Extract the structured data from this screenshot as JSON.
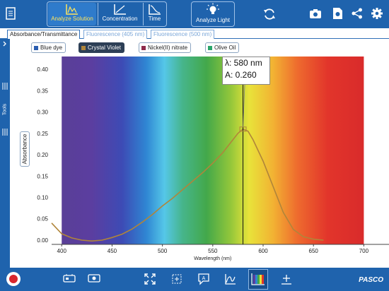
{
  "toolbar": {
    "analyze_solution": "Analyze Solution",
    "concentration": "Concentration",
    "time": "Time",
    "analyze_light": "Analyze Light"
  },
  "tabs": [
    {
      "label": "Absorbance/Transmittance",
      "active": true
    },
    {
      "label": "Fluorescence (405 nm)",
      "active": false
    },
    {
      "label": "Fluorescence (500 nm)",
      "active": false
    }
  ],
  "sidebar": {
    "tools_label": "Tools"
  },
  "legend": [
    {
      "label": "Blue dye",
      "color": "#2a5db0",
      "selected": false
    },
    {
      "label": "Crystal Violet",
      "color": "#b0853a",
      "selected": true
    },
    {
      "label": "Nickel(II) nitrate",
      "color": "#8e2a4a",
      "selected": false
    },
    {
      "label": "Olive Oil",
      "color": "#2aa56a",
      "selected": false
    }
  ],
  "cursor": {
    "wavelength": "λ: 580 nm",
    "absorbance": "A: 0.260"
  },
  "chart_data": {
    "type": "line",
    "xlabel": "Wavelength (nm)",
    "ylabel": "Absorbance",
    "xlim": [
      390,
      725
    ],
    "ylim": [
      -0.01,
      0.43
    ],
    "x_ticks": [
      400,
      450,
      500,
      550,
      600,
      650,
      700
    ],
    "y_ticks": [
      0.0,
      0.05,
      0.1,
      0.15,
      0.2,
      0.25,
      0.3,
      0.35,
      0.4
    ],
    "y_tick_labels": [
      "0.00",
      "0.05",
      "0.10",
      "0.15",
      "0.20",
      "0.25",
      "0.30",
      "0.35",
      "0.40"
    ],
    "background": "visible spectrum 400–700 nm",
    "series": [
      {
        "name": "Crystal Violet",
        "color": "#b0853a",
        "x": [
          390,
          400,
          410,
          420,
          430,
          440,
          450,
          460,
          470,
          480,
          490,
          500,
          510,
          520,
          530,
          540,
          550,
          560,
          570,
          575,
          580,
          585,
          590,
          600,
          610,
          620,
          630,
          640,
          650,
          660
        ],
        "y": [
          0.04,
          0.015,
          0.005,
          0.0,
          -0.002,
          0.0,
          0.006,
          0.014,
          0.026,
          0.042,
          0.06,
          0.08,
          0.098,
          0.118,
          0.138,
          0.158,
          0.18,
          0.205,
          0.235,
          0.25,
          0.26,
          0.255,
          0.235,
          0.185,
          0.125,
          0.065,
          0.025,
          0.008,
          0.002,
          0.0
        ]
      }
    ],
    "cursor_x": 580
  },
  "bottom": {
    "brand": "PASCO"
  }
}
